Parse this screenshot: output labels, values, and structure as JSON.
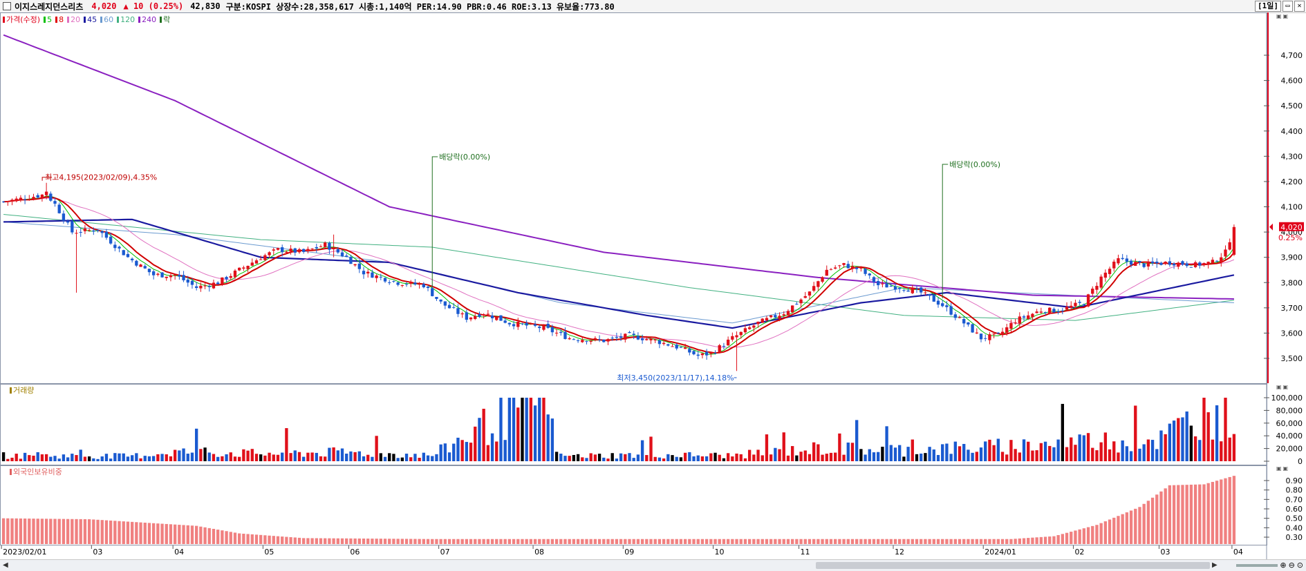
{
  "header": {
    "stock_name": "이지스레지던스리츠",
    "price": "4,020",
    "change": "▲  10  (0.25%)",
    "volume": "42,830",
    "details": "구분:KOSPI  상장수:28,358,617  시총:1,140억  PER:14.90  PBR:0.46  ROE:3.13  유보율:773.80",
    "period": "[1일]",
    "min_btn": "▭",
    "close_btn": "✕"
  },
  "legend": {
    "items": [
      {
        "label": "가격(수정)",
        "color": "#e0001a"
      },
      {
        "label": "5",
        "color": "#00c000"
      },
      {
        "label": "8",
        "color": "#e00000"
      },
      {
        "label": "20",
        "color": "#e070c0"
      },
      {
        "label": "45",
        "color": "#1a1aa0"
      },
      {
        "label": "60",
        "color": "#6a9ad0"
      },
      {
        "label": "120",
        "color": "#40b080"
      },
      {
        "label": "240",
        "color": "#8a20c0"
      },
      {
        "label": "락",
        "color": "#207020"
      }
    ]
  },
  "panels": {
    "volume_label": "거래량",
    "foreign_label": "외국인보유비중"
  },
  "annotations": {
    "high": "최고4,195(2023/02/09),4.35%",
    "low": "최저3,450(2023/11/17),14.18%",
    "dividend1": "배당락(0.00%)",
    "dividend2": "배당락(0.00%)",
    "last_price": "4,020",
    "last_change": "0.25%"
  },
  "chart_data": [
    {
      "type": "candlestick",
      "title": "",
      "x_ticks": [
        "2023/02/01",
        "03",
        "04",
        "05",
        "06",
        "07",
        "08",
        "09",
        "10",
        "11",
        "12",
        "2024/01",
        "02",
        "03",
        "04"
      ],
      "y_ticks": [
        "3,500",
        "3,600",
        "3,700",
        "3,800",
        "3,900",
        "4,000",
        "4,100",
        "4,200",
        "4,300",
        "4,400",
        "4,500",
        "4,600",
        "4,700"
      ],
      "ylim": [
        3420,
        4860
      ],
      "close_anchors": [
        [
          0,
          4120
        ],
        [
          10,
          4150
        ],
        [
          12,
          4110
        ],
        [
          16,
          4000
        ],
        [
          22,
          4010
        ],
        [
          29,
          3900
        ],
        [
          35,
          3830
        ],
        [
          40,
          3830
        ],
        [
          45,
          3780
        ],
        [
          50,
          3800
        ],
        [
          55,
          3850
        ],
        [
          60,
          3900
        ],
        [
          64,
          3930
        ],
        [
          70,
          3920
        ],
        [
          75,
          3950
        ],
        [
          80,
          3900
        ],
        [
          84,
          3840
        ],
        [
          92,
          3800
        ],
        [
          98,
          3790
        ],
        [
          102,
          3720
        ],
        [
          108,
          3660
        ],
        [
          112,
          3680
        ],
        [
          118,
          3640
        ],
        [
          126,
          3620
        ],
        [
          132,
          3580
        ],
        [
          140,
          3570
        ],
        [
          146,
          3590
        ],
        [
          152,
          3570
        ],
        [
          158,
          3540
        ],
        [
          162,
          3510
        ],
        [
          165,
          3520
        ],
        [
          170,
          3580
        ],
        [
          176,
          3640
        ],
        [
          182,
          3680
        ],
        [
          188,
          3760
        ],
        [
          192,
          3850
        ],
        [
          196,
          3870
        ],
        [
          200,
          3850
        ],
        [
          204,
          3790
        ],
        [
          210,
          3780
        ],
        [
          214,
          3760
        ],
        [
          219,
          3710
        ],
        [
          224,
          3640
        ],
        [
          228,
          3580
        ],
        [
          232,
          3590
        ],
        [
          236,
          3650
        ],
        [
          242,
          3690
        ],
        [
          246,
          3690
        ],
        [
          252,
          3720
        ],
        [
          256,
          3820
        ],
        [
          260,
          3890
        ],
        [
          266,
          3870
        ],
        [
          272,
          3880
        ],
        [
          278,
          3870
        ],
        [
          282,
          3880
        ],
        [
          285,
          3920
        ],
        [
          287,
          4020
        ]
      ],
      "moving_averages": {
        "45": [
          [
            0,
            4040
          ],
          [
            30,
            4050
          ],
          [
            60,
            3900
          ],
          [
            90,
            3880
          ],
          [
            120,
            3760
          ],
          [
            150,
            3670
          ],
          [
            170,
            3620
          ],
          [
            200,
            3720
          ],
          [
            220,
            3760
          ],
          [
            250,
            3700
          ],
          [
            287,
            3830
          ]
        ],
        "240": [
          [
            0,
            4780
          ],
          [
            40,
            4520
          ],
          [
            90,
            4100
          ],
          [
            140,
            3920
          ],
          [
            190,
            3820
          ],
          [
            240,
            3750
          ],
          [
            287,
            3735
          ]
        ],
        "60": [
          [
            0,
            4040
          ],
          [
            40,
            3990
          ],
          [
            90,
            3880
          ],
          [
            130,
            3720
          ],
          [
            170,
            3640
          ],
          [
            210,
            3780
          ],
          [
            287,
            3720
          ]
        ],
        "120": [
          [
            0,
            4070
          ],
          [
            60,
            3970
          ],
          [
            100,
            3940
          ],
          [
            160,
            3780
          ],
          [
            210,
            3670
          ],
          [
            250,
            3650
          ],
          [
            287,
            3730
          ]
        ]
      },
      "high": {
        "label": "최고4,195(2023/02/09),4.35%",
        "value": 4195
      },
      "low": {
        "label": "최저3,450(2023/11/17),14.18%",
        "value": 3450
      },
      "last": {
        "value": 4020,
        "change_pct": 0.25
      }
    },
    {
      "type": "bar",
      "title": "거래량",
      "y_ticks": [
        "0",
        "20,000",
        "40,000",
        "60,000",
        "80,000",
        "100,000"
      ],
      "ylim": [
        0,
        110000
      ],
      "values_profile": [
        [
          0,
          9000
        ],
        [
          30,
          8000
        ],
        [
          40,
          15000
        ],
        [
          60,
          12000
        ],
        [
          80,
          14000
        ],
        [
          100,
          9000
        ],
        [
          125,
          104000
        ],
        [
          130,
          8000
        ],
        [
          150,
          10000
        ],
        [
          170,
          9000
        ],
        [
          190,
          20000
        ],
        [
          210,
          18000
        ],
        [
          230,
          22000
        ],
        [
          250,
          30000
        ],
        [
          270,
          35000
        ],
        [
          283,
          88000
        ],
        [
          287,
          42830
        ]
      ]
    },
    {
      "type": "bar",
      "title": "외국인보유비중",
      "y_ticks": [
        "0.30",
        "0.40",
        "0.50",
        "0.60",
        "0.70",
        "0.80",
        "0.90"
      ],
      "ylim": [
        0.2,
        0.97
      ],
      "values_profile": [
        [
          0,
          0.5
        ],
        [
          20,
          0.49
        ],
        [
          45,
          0.42
        ],
        [
          55,
          0.34
        ],
        [
          70,
          0.29
        ],
        [
          100,
          0.28
        ],
        [
          160,
          0.28
        ],
        [
          235,
          0.28
        ],
        [
          245,
          0.31
        ],
        [
          255,
          0.43
        ],
        [
          265,
          0.62
        ],
        [
          272,
          0.85
        ],
        [
          280,
          0.86
        ],
        [
          287,
          0.95
        ]
      ]
    }
  ]
}
